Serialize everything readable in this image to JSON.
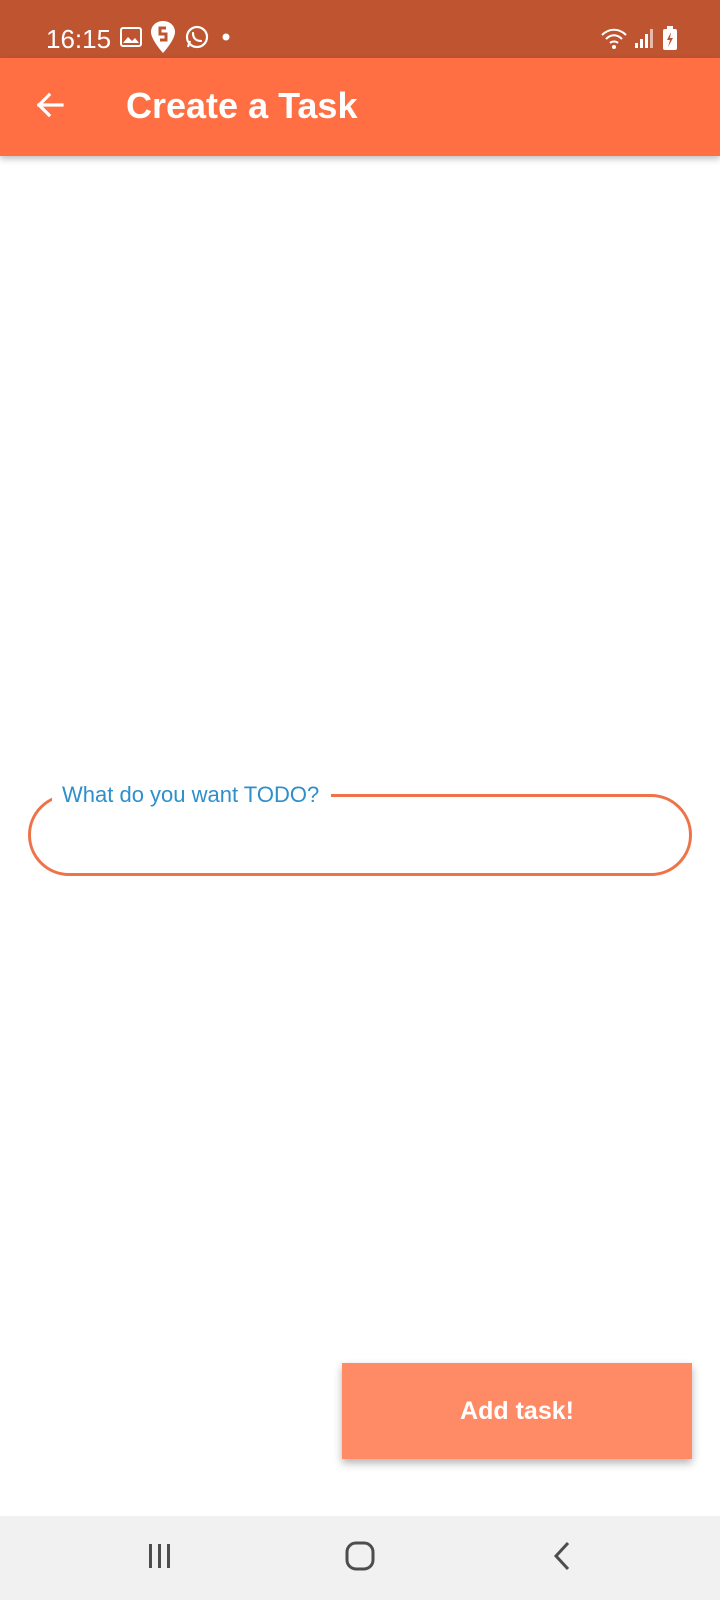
{
  "status_bar": {
    "time": "16:15",
    "left_icons": [
      "gallery-icon",
      "swiggy-icon",
      "whatsapp-icon",
      "notification-dot"
    ],
    "right_icons": [
      "wifi-icon",
      "signal-icon",
      "battery-icon"
    ]
  },
  "app_bar": {
    "title": "Create a Task",
    "back_icon": "arrow-left-icon",
    "color": "#ff6f43"
  },
  "task_field": {
    "label": "What do you want TODO?",
    "value": "",
    "border_color": "#ee7348",
    "label_color": "#2e8fcb"
  },
  "add_button": {
    "label": "Add task!",
    "color": "#ff8b66"
  },
  "nav_bar": {
    "buttons": [
      "recent-apps-icon",
      "home-icon",
      "back-icon"
    ]
  }
}
